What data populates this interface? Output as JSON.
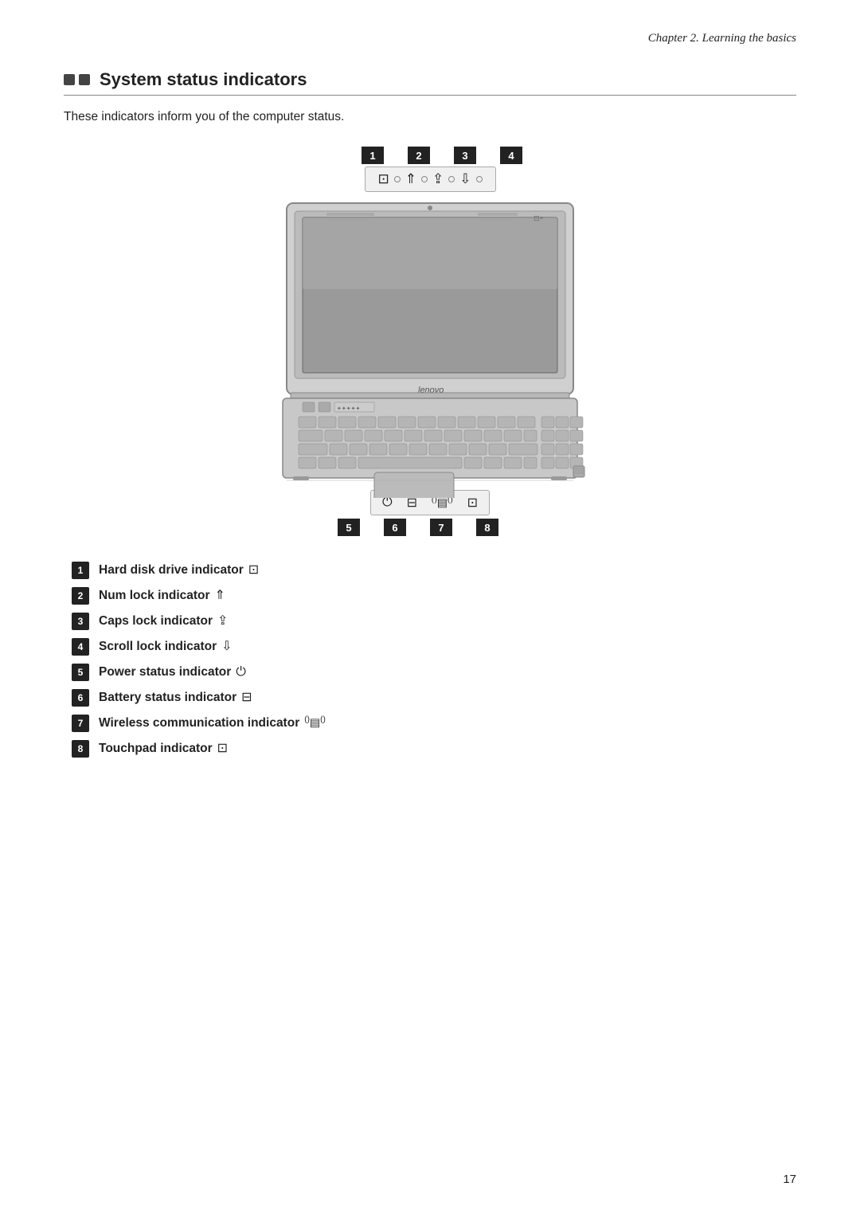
{
  "header": {
    "text": "Chapter 2. Learning the basics"
  },
  "section": {
    "dots_count": 2,
    "title": "System status indicators",
    "intro": "These indicators inform you of the computer status."
  },
  "top_indicators": {
    "numbers": [
      "1",
      "2",
      "3",
      "4"
    ]
  },
  "bottom_indicators": {
    "numbers": [
      "5",
      "6",
      "7",
      "8"
    ]
  },
  "items": [
    {
      "num": "1",
      "label": "Hard disk drive indicator",
      "icon": "🖴",
      "icon_text": "⊡"
    },
    {
      "num": "2",
      "label": "Num lock indicator",
      "icon": "⇧"
    },
    {
      "num": "3",
      "label": "Caps lock indicator",
      "icon": "⇪"
    },
    {
      "num": "4",
      "label": "Scroll lock indicator",
      "icon": "⇩"
    },
    {
      "num": "5",
      "label": "Power status indicator",
      "icon": "⏻"
    },
    {
      "num": "6",
      "label": "Battery status indicator",
      "icon": "⊟"
    },
    {
      "num": "7",
      "label": "Wireless communication indicator",
      "icon": "📶"
    },
    {
      "num": "8",
      "label": "Touchpad indicator",
      "icon": "⊠"
    }
  ],
  "page_number": "17"
}
